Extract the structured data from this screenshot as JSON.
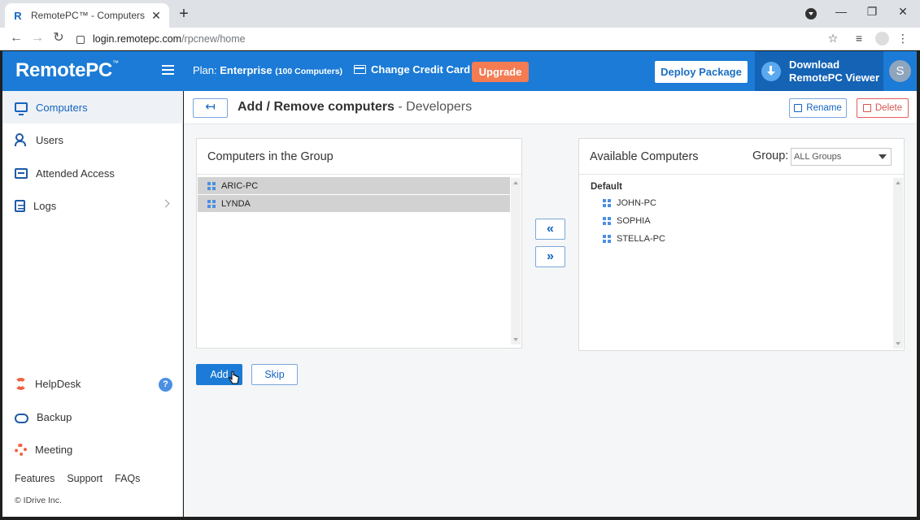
{
  "browser": {
    "tab_title": "RemotePC™ - Computers",
    "url_host": "login.remotepc.com",
    "url_path": "/rpcnew/home"
  },
  "header": {
    "logo": "RemotePC",
    "logo_tm": "™",
    "plan_label": "Plan:",
    "plan_name": "Enterprise",
    "plan_count": "(100 Computers)",
    "change_card": "Change Credit Card",
    "upgrade": "Upgrade",
    "deploy": "Deploy Package",
    "download_line1": "Download",
    "download_line2": "RemotePC Viewer",
    "avatar_initial": "S"
  },
  "sidebar": {
    "items": [
      {
        "label": "Computers"
      },
      {
        "label": "Users"
      },
      {
        "label": "Attended Access"
      },
      {
        "label": "Logs"
      },
      {
        "label": "HelpDesk"
      },
      {
        "label": "Backup"
      },
      {
        "label": "Meeting"
      }
    ],
    "help_badge": "?",
    "links": [
      "Features",
      "Support",
      "FAQs"
    ],
    "copyright": "© IDrive Inc."
  },
  "main": {
    "back_arrow": "↤",
    "title": "Add / Remove computers",
    "title_sep": " - ",
    "group_name": "Developers",
    "rename": "Rename",
    "delete": "Delete",
    "left_panel": {
      "title": "Computers in the Group",
      "items": [
        "ARIC-PC",
        "LYNDA"
      ]
    },
    "move_left": "«",
    "move_right": "»",
    "right_panel": {
      "title": "Available Computers",
      "group_label": "Group:",
      "group_select": "ALL Groups",
      "section": "Default",
      "items": [
        "JOHN-PC",
        "SOPHIA",
        "STELLA-PC"
      ]
    },
    "add": "Add",
    "skip": "Skip"
  }
}
